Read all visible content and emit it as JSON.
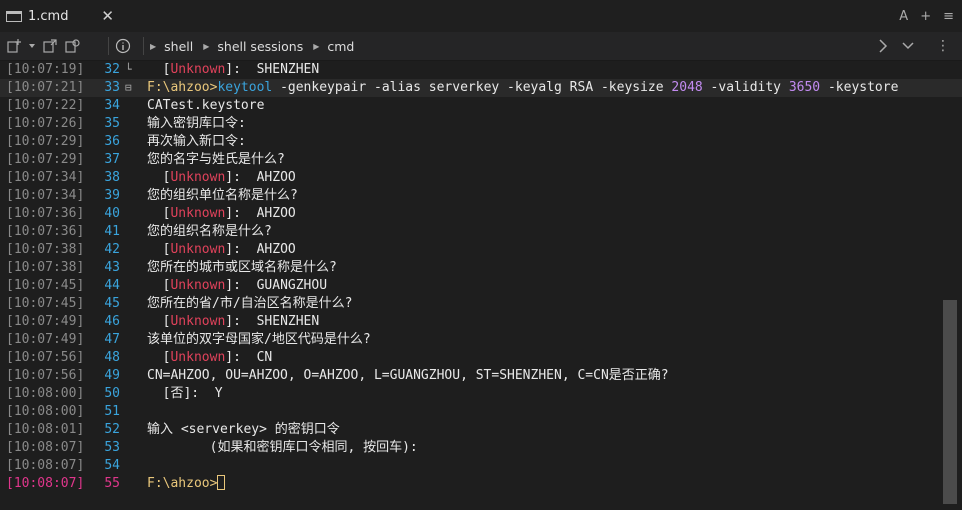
{
  "tab": {
    "title": "1.cmd",
    "close": "✕"
  },
  "title_actions": {
    "a_label": "A",
    "plus": "+",
    "menu": "≡"
  },
  "toolbar": {
    "new_tab_icon": "new-tab-icon",
    "breadcrumbs": [
      "shell",
      "shell sessions",
      "cmd"
    ],
    "info_icon": "info-icon",
    "more": "⋮"
  },
  "terminal": {
    "lines": [
      {
        "ts": "[10:07:19]",
        "ln": "32",
        "fold": "└",
        "parts": [
          {
            "t": "  ["
          },
          {
            "t": "Unknown",
            "c": "unk"
          },
          {
            "t": "]:  SHENZHEN"
          }
        ]
      },
      {
        "ts": "[10:07:21]",
        "ln": "33",
        "fold": "⊟",
        "current": true,
        "parts": [
          {
            "t": "F:\\ahzoo>",
            "c": "prompt-path"
          },
          {
            "t": "keytool",
            "c": "cmdname"
          },
          {
            "t": " -genkeypair -alias serverkey -keyalg RSA -keysize "
          },
          {
            "t": "2048",
            "c": "num"
          },
          {
            "t": " -validity "
          },
          {
            "t": "3650",
            "c": "num"
          },
          {
            "t": " -keystore"
          }
        ]
      },
      {
        "ts": "[10:07:22]",
        "ln": "34",
        "parts": [
          {
            "t": "CATest.keystore"
          }
        ]
      },
      {
        "ts": "[10:07:26]",
        "ln": "35",
        "parts": [
          {
            "t": "输入密钥库口令:"
          }
        ]
      },
      {
        "ts": "[10:07:29]",
        "ln": "36",
        "parts": [
          {
            "t": "再次输入新口令:"
          }
        ]
      },
      {
        "ts": "[10:07:29]",
        "ln": "37",
        "parts": [
          {
            "t": "您的名字与姓氏是什么?"
          }
        ]
      },
      {
        "ts": "[10:07:34]",
        "ln": "38",
        "parts": [
          {
            "t": "  ["
          },
          {
            "t": "Unknown",
            "c": "unk"
          },
          {
            "t": "]:  AHZOO"
          }
        ]
      },
      {
        "ts": "[10:07:34]",
        "ln": "39",
        "parts": [
          {
            "t": "您的组织单位名称是什么?"
          }
        ]
      },
      {
        "ts": "[10:07:36]",
        "ln": "40",
        "parts": [
          {
            "t": "  ["
          },
          {
            "t": "Unknown",
            "c": "unk"
          },
          {
            "t": "]:  AHZOO"
          }
        ]
      },
      {
        "ts": "[10:07:36]",
        "ln": "41",
        "parts": [
          {
            "t": "您的组织名称是什么?"
          }
        ]
      },
      {
        "ts": "[10:07:38]",
        "ln": "42",
        "parts": [
          {
            "t": "  ["
          },
          {
            "t": "Unknown",
            "c": "unk"
          },
          {
            "t": "]:  AHZOO"
          }
        ]
      },
      {
        "ts": "[10:07:38]",
        "ln": "43",
        "parts": [
          {
            "t": "您所在的城市或区域名称是什么?"
          }
        ]
      },
      {
        "ts": "[10:07:45]",
        "ln": "44",
        "parts": [
          {
            "t": "  ["
          },
          {
            "t": "Unknown",
            "c": "unk"
          },
          {
            "t": "]:  GUANGZHOU"
          }
        ]
      },
      {
        "ts": "[10:07:45]",
        "ln": "45",
        "parts": [
          {
            "t": "您所在的省/市/自治区名称是什么?"
          }
        ]
      },
      {
        "ts": "[10:07:49]",
        "ln": "46",
        "parts": [
          {
            "t": "  ["
          },
          {
            "t": "Unknown",
            "c": "unk"
          },
          {
            "t": "]:  SHENZHEN"
          }
        ]
      },
      {
        "ts": "[10:07:49]",
        "ln": "47",
        "parts": [
          {
            "t": "该单位的双字母国家/地区代码是什么?"
          }
        ]
      },
      {
        "ts": "[10:07:56]",
        "ln": "48",
        "parts": [
          {
            "t": "  ["
          },
          {
            "t": "Unknown",
            "c": "unk"
          },
          {
            "t": "]:  CN"
          }
        ]
      },
      {
        "ts": "[10:07:56]",
        "ln": "49",
        "parts": [
          {
            "t": "CN=AHZOO, OU=AHZOO, O=AHZOO, L=GUANGZHOU, ST=SHENZHEN, C=CN是否正确?"
          }
        ]
      },
      {
        "ts": "[10:08:00]",
        "ln": "50",
        "parts": [
          {
            "t": "  [否]:  Y"
          }
        ]
      },
      {
        "ts": "[10:08:00]",
        "ln": "51",
        "parts": [
          {
            "t": ""
          }
        ]
      },
      {
        "ts": "[10:08:01]",
        "ln": "52",
        "parts": [
          {
            "t": "输入 <serverkey> 的密钥口令"
          }
        ]
      },
      {
        "ts": "[10:08:07]",
        "ln": "53",
        "parts": [
          {
            "t": "        (如果和密钥库口令相同, 按回车):"
          }
        ]
      },
      {
        "ts": "[10:08:07]",
        "ln": "54",
        "parts": [
          {
            "t": ""
          }
        ]
      },
      {
        "ts": "[10:08:07]",
        "ln": "55",
        "active": true,
        "parts": [
          {
            "t": "F:\\ahzoo>",
            "c": "prompt-path"
          }
        ],
        "cursor": true
      }
    ]
  }
}
